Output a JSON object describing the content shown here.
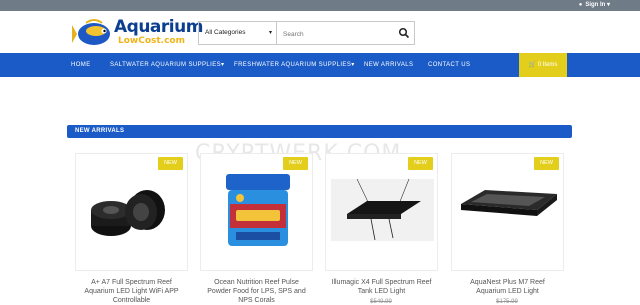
{
  "topbar": {
    "signin_label": "Sign In"
  },
  "logo": {
    "line1": "Aquarium",
    "line2": "LowCost.com"
  },
  "search": {
    "category_selected": "All Categories",
    "placeholder": "Search"
  },
  "nav": {
    "items": [
      {
        "label": "HOME"
      },
      {
        "label": "SALTWATER AQUARIUM SUPPLIES"
      },
      {
        "label": "FRESHWATER AQUARIUM SUPPLIES"
      },
      {
        "label": "NEW ARRIVALS"
      },
      {
        "label": "CONTACT US"
      }
    ],
    "cart_label": "0 Items"
  },
  "section": {
    "title": "NEW ARRIVALS"
  },
  "watermark": "CRYPTWERK.COM",
  "products": [
    {
      "badge": "NEW",
      "name_line1": "A+ A7 Full Spectrum Reef",
      "name_line2": "Aquarium LED Light WiFi APP",
      "name_line3": "Controllable",
      "price": ""
    },
    {
      "badge": "NEW",
      "name_line1": "Ocean Nutrition Reef Pulse",
      "name_line2": "Powder Food for LPS, SPS and",
      "name_line3": "NPS Corals",
      "price": ""
    },
    {
      "badge": "NEW",
      "name_line1": "Illumagic X4 Full Spectrum Reef",
      "name_line2": "Tank LED Light",
      "name_line3": "",
      "price": "$549.99"
    },
    {
      "badge": "NEW",
      "name_line1": "AquaNest Plus M7 Reef",
      "name_line2": "Aquarium LED Light",
      "name_line3": "",
      "price": "$175.99"
    }
  ],
  "colors": {
    "nav_blue": "#1a5bc7",
    "badge_yellow": "#e3cf1b",
    "topbar_gray": "#6f7b86"
  }
}
